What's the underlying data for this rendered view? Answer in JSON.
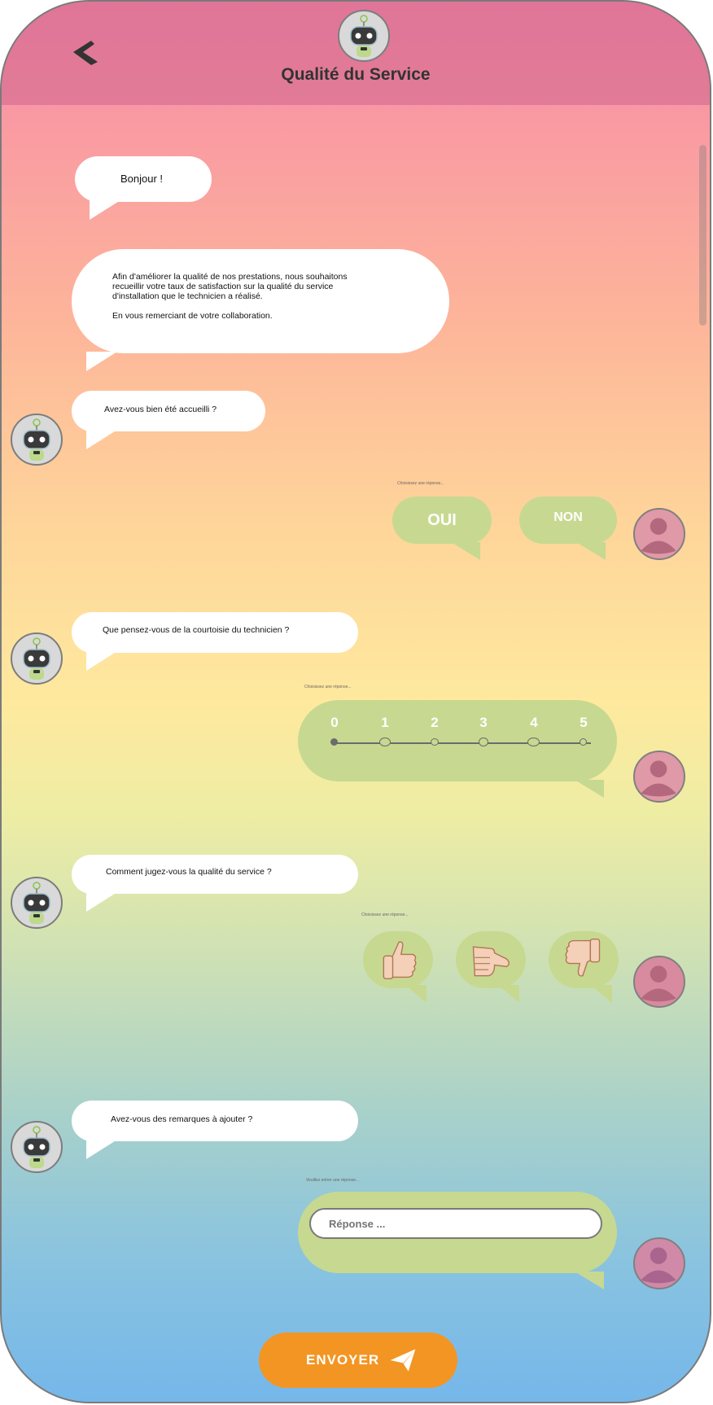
{
  "header": {
    "title": "Qualité du Service",
    "back_icon": "back-chevron-icon",
    "avatar_icon": "robot-avatar-icon"
  },
  "messages": {
    "greeting": "Bonjour !",
    "intro_lines": [
      "Afin d'améliorer la qualité de nos prestations, nous souhaitons",
      "recueillir votre taux de satisfaction sur la qualité du service",
      "d'installation que le technicien a réalisé.",
      "",
      "En vous remerciant de votre collaboration."
    ],
    "q1": "Avez-vous bien été accueilli ?",
    "q2": "Que pensez-vous de la courtoisie du technicien ?",
    "q3": "Comment jugez-vous la qualité du service ?",
    "q4": "Avez-vous des remarques à ajouter ?"
  },
  "answers": {
    "hint_choose": "Choisissez une réponse...",
    "hint_enter": "Veuillez entrer une réponse...",
    "yes": "OUI",
    "no": "NON",
    "scale": [
      "0",
      "1",
      "2",
      "3",
      "4",
      "5"
    ],
    "scale_selected": 0,
    "thumbs": [
      "thumbs-up-icon",
      "thumb-sideways-icon",
      "thumbs-down-icon"
    ],
    "response_placeholder": "Réponse ..."
  },
  "send_label": "ENVOYER",
  "colors": {
    "accent": "#f39523",
    "answer_bubble": "#c7d990",
    "header": "#d7739a"
  }
}
